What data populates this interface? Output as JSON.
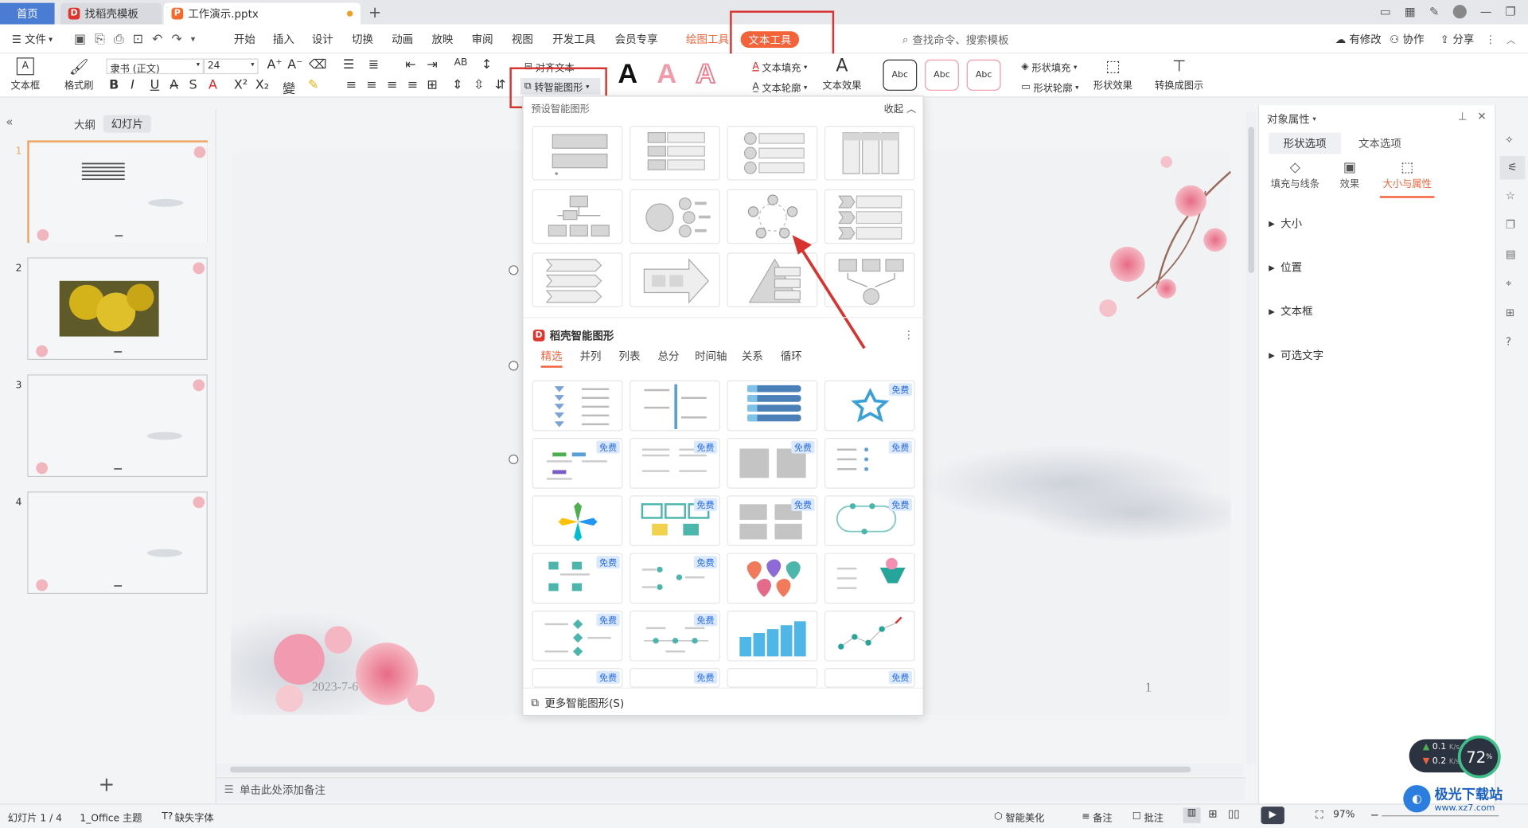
{
  "tabs": {
    "home": "首页",
    "template": "找稻壳模板",
    "doc": "工作演示.pptx",
    "new_tab": "+"
  },
  "menubar": {
    "file": "文件",
    "items": [
      "开始",
      "插入",
      "设计",
      "切换",
      "动画",
      "放映",
      "审阅",
      "视图",
      "开发工具",
      "会员专享"
    ],
    "drawing_tools": "绘图工具",
    "text_tools": "文本工具",
    "search_placeholder": "查找命令、搜索模板",
    "has_changes": "有修改",
    "collaborate": "协作",
    "share": "分享"
  },
  "ribbon": {
    "textbox": "文本框",
    "format_painter": "格式刷",
    "font_name": "隶书 (正文)",
    "font_size": "24",
    "align_text": "对齐文本",
    "smartart": "转智能图形",
    "text_fill": "文本填充",
    "text_outline": "文本轮廓",
    "text_effect": "文本效果",
    "abc1": "Abc",
    "abc2": "Abc",
    "abc3": "Abc",
    "shape_fill": "形状填充",
    "shape_outline": "形状轮廓",
    "shape_effect": "形状效果",
    "convert_pic": "转换成图示"
  },
  "left": {
    "outline_tab": "大纲",
    "slides_tab": "幻灯片",
    "slide_numbers": [
      "1",
      "2",
      "3",
      "4"
    ],
    "add": "+"
  },
  "dropdown": {
    "preset_title": "预设智能图形",
    "collapse": "收起",
    "daoke_title": "稻壳智能图形",
    "tabs": [
      "精选",
      "并列",
      "列表",
      "总分",
      "时间轴",
      "关系",
      "循环"
    ],
    "free": "免费",
    "more": "更多智能图形(S)"
  },
  "slide": {
    "date": "2023-7-6",
    "page": "1"
  },
  "notes_placeholder": "单击此处添加备注",
  "right": {
    "title": "对象属性",
    "tab_shape": "形状选项",
    "tab_text": "文本选项",
    "sub_fill": "填充与线条",
    "sub_effect": "效果",
    "sub_size": "大小与属性",
    "sections": [
      "大小",
      "位置",
      "文本框",
      "可选文字"
    ]
  },
  "status": {
    "slide_count": "幻灯片 1 / 4",
    "theme": "1_Office 主题",
    "missing_font": "缺失字体",
    "smart_beautify": "智能美化",
    "notes": "备注",
    "comments": "批注",
    "zoom": "97%",
    "net_up": "0.1",
    "net_down": "0.2",
    "net_unit": "K/s",
    "net_percent": "72",
    "watermark": "极光下载站",
    "watermark_url": "www.xz7.com"
  },
  "colors": {
    "accent": "#4b7cd3",
    "highlight": "#d9332f",
    "text_tool": "#f4623a",
    "free_badge": "#2a6de0"
  }
}
